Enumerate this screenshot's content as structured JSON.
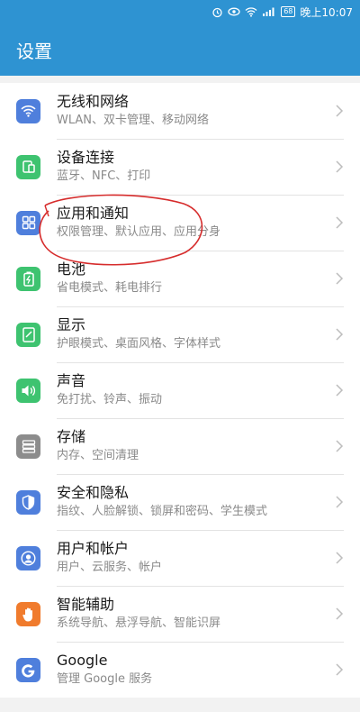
{
  "statusbar": {
    "battery": "68",
    "time": "晚上10:07"
  },
  "appbar": {
    "title": "设置"
  },
  "items": [
    {
      "title": "无线和网络",
      "subtitle": "WLAN、双卡管理、移动网络",
      "icon": "wifi-icon",
      "color": "#4f7fdc"
    },
    {
      "title": "设备连接",
      "subtitle": "蓝牙、NFC、打印",
      "icon": "device-connect-icon",
      "color": "#3ec370"
    },
    {
      "title": "应用和通知",
      "subtitle": "权限管理、默认应用、应用分身",
      "icon": "apps-grid-icon",
      "color": "#4f7fdc"
    },
    {
      "title": "电池",
      "subtitle": "省电模式、耗电排行",
      "icon": "battery-icon",
      "color": "#3ec370"
    },
    {
      "title": "显示",
      "subtitle": "护眼模式、桌面风格、字体样式",
      "icon": "display-icon",
      "color": "#3ec370"
    },
    {
      "title": "声音",
      "subtitle": "免打扰、铃声、振动",
      "icon": "speaker-icon",
      "color": "#3ec370"
    },
    {
      "title": "存储",
      "subtitle": "内存、空间清理",
      "icon": "storage-icon",
      "color": "#8c8c8c"
    },
    {
      "title": "安全和隐私",
      "subtitle": "指纹、人脸解锁、锁屏和密码、学生模式",
      "icon": "shield-icon",
      "color": "#4f7fdc"
    },
    {
      "title": "用户和帐户",
      "subtitle": "用户、云服务、帐户",
      "icon": "user-icon",
      "color": "#4f7fdc"
    },
    {
      "title": "智能辅助",
      "subtitle": "系统导航、悬浮导航、智能识屏",
      "icon": "hand-icon",
      "color": "#f07b2d"
    },
    {
      "title": "Google",
      "subtitle": "管理 Google 服务",
      "icon": "google-icon",
      "color": "#4f7fdc"
    }
  ],
  "colors": {
    "accent": "#2e93d2",
    "annotation": "#d62c2c"
  }
}
